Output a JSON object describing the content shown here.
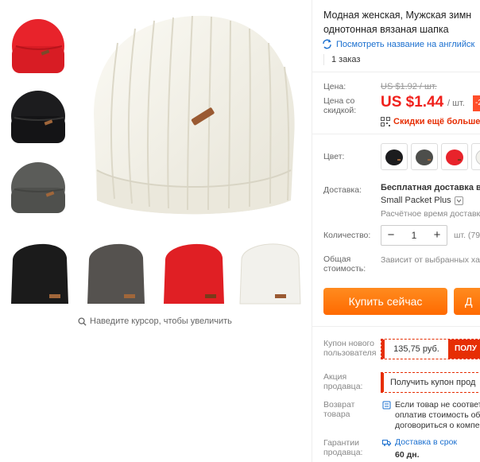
{
  "gallery": {
    "zoom_hint": "Наведите курсор, чтобы увеличить",
    "side_thumbs": [
      {
        "color": "#e8232b",
        "icon": "red-beanie"
      },
      {
        "color": "#1c1c1e",
        "icon": "black-beanie"
      },
      {
        "color": "#5b5c59",
        "icon": "gray-beanie"
      }
    ],
    "row_thumbs": [
      {
        "color": "#1b1b1b",
        "icon": "black-beanie"
      },
      {
        "color": "#55524f",
        "icon": "charcoal-beanie"
      },
      {
        "color": "#e01f24",
        "icon": "red-beanie"
      },
      {
        "color": "#f2f1ec",
        "icon": "white-beanie"
      }
    ],
    "main_color": "#f4f2ea"
  },
  "product": {
    "title_line1": "Модная женская, Мужская зимн",
    "title_line2": "однотонная вязаная шапка",
    "translate_link": "Посмотреть название на английск",
    "orders": "1 заказ"
  },
  "price": {
    "label": "Цена:",
    "old": "US $1.92 / шт.",
    "sale_label_1": "Цена со",
    "sale_label_2": "скидкой:",
    "sale": "US $1.44",
    "unit": "/ шт.",
    "badge": "-2",
    "promo": "Скидки ещё больше в"
  },
  "options": {
    "color_label": "Цвет:",
    "swatches": [
      {
        "color": "#1c1c1e",
        "selected": false
      },
      {
        "color": "#4d4e4b",
        "selected": false
      },
      {
        "color": "#e8232b",
        "selected": false
      },
      {
        "color": "#f2f1ec",
        "selected": false
      }
    ],
    "delivery_label": "Доставка:",
    "delivery_value": "Бесплатная доставка в",
    "delivery_method": "Small Packet Plus",
    "delivery_estimate": "Расчётное время доставк",
    "qty_label": "Количество:",
    "qty_minus": "−",
    "qty_value": "1",
    "qty_plus": "+",
    "qty_unit": "шт. (79",
    "total_label_1": "Общая",
    "total_label_2": "стоимость:",
    "total_value": "Зависит от выбранных ха"
  },
  "actions": {
    "buy": "Купить сейчас",
    "cart": "Д"
  },
  "coupons": {
    "new_user_label_1": "Купон нового",
    "new_user_label_2": "пользователя",
    "new_user_amount": "135,75 руб.",
    "new_user_get": "ПОЛУ",
    "seller_label_1": "Акция",
    "seller_label_2": "продавца:",
    "seller_get": "Получить купон прод"
  },
  "service": {
    "return_label_1": "Возврат",
    "return_label_2": "товара",
    "return_line1": "Если товар не соответ",
    "return_line2": "оплатив стоимость об",
    "return_line3": "договориться о компе",
    "guarantee_label_1": "Гарантии",
    "guarantee_label_2": "продавца:",
    "guarantee_line1": "Доставка в срок",
    "guarantee_line2": "60 дн."
  }
}
